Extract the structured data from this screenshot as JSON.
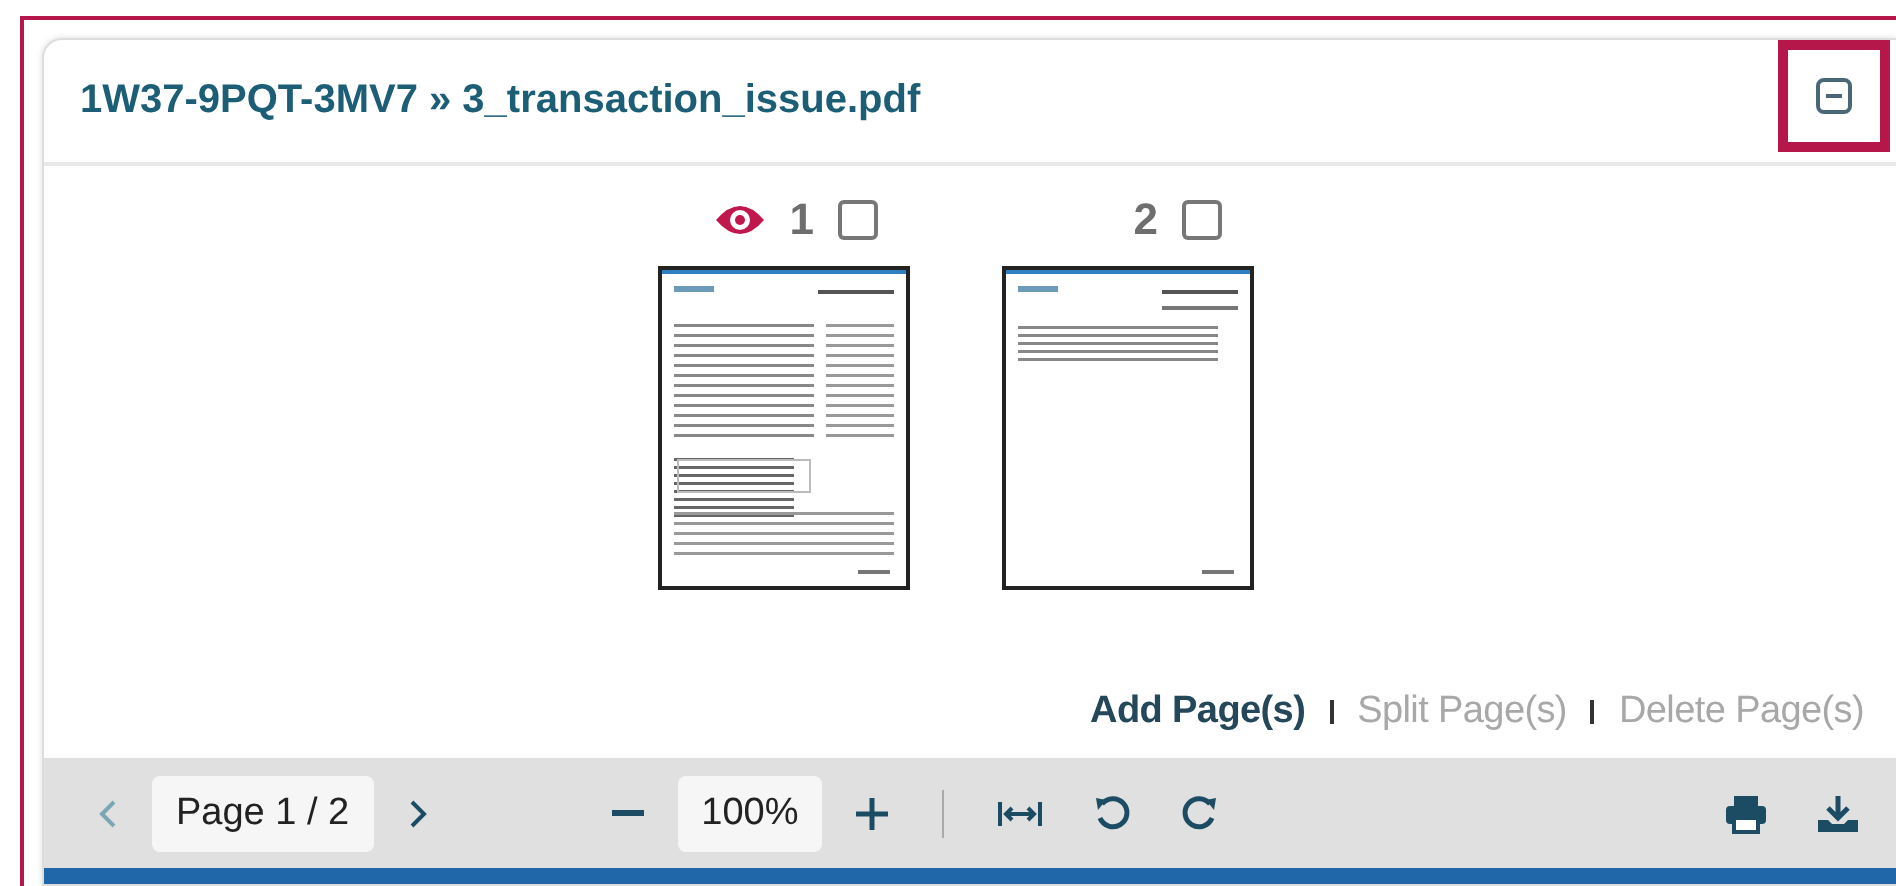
{
  "title": "1W37-9PQT-3MV7 » 3_transaction_issue.pdf",
  "pages": [
    {
      "number": "1",
      "viewing": true,
      "checked": false,
      "kind": "dense"
    },
    {
      "number": "2",
      "viewing": false,
      "checked": false,
      "kind": "sparse"
    }
  ],
  "actions": [
    {
      "label": "Add Page(s)",
      "disabled": false
    },
    {
      "label": "Split Page(s)",
      "disabled": true
    },
    {
      "label": "Delete Page(s)",
      "disabled": true
    }
  ],
  "toolbar": {
    "prev_disabled": true,
    "next_disabled": false,
    "page": "Page 1 / 2",
    "zoom": "100%"
  }
}
